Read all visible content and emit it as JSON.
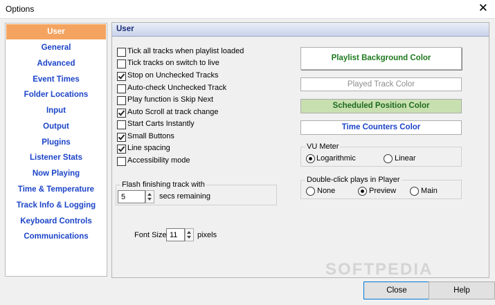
{
  "window": {
    "title": "Options",
    "close_glyph": "✕"
  },
  "sidebar": {
    "items": [
      {
        "label": "User",
        "active": true
      },
      {
        "label": "General"
      },
      {
        "label": "Advanced"
      },
      {
        "label": "Event Times"
      },
      {
        "label": "Folder Locations"
      },
      {
        "label": "Input"
      },
      {
        "label": "Output"
      },
      {
        "label": "Plugins"
      },
      {
        "label": "Listener Stats"
      },
      {
        "label": "Now Playing"
      },
      {
        "label": "Time & Temperature"
      },
      {
        "label": "Track Info & Logging"
      },
      {
        "label": "Keyboard Controls"
      },
      {
        "label": "Communications"
      }
    ]
  },
  "panel": {
    "title": "User",
    "checkboxes": [
      {
        "label": "Tick all tracks when playlist loaded",
        "checked": false
      },
      {
        "label": "Tick tracks on switch to live",
        "checked": false
      },
      {
        "label": "Stop on Unchecked Tracks",
        "checked": true
      },
      {
        "label": "Auto-check Unchecked Track",
        "checked": false
      },
      {
        "label": "Play function is Skip Next",
        "checked": false
      },
      {
        "label": "Auto Scroll at track change",
        "checked": true
      },
      {
        "label": "Start Carts Instantly",
        "checked": false
      },
      {
        "label": "Small Buttons",
        "checked": true
      },
      {
        "label": "Line spacing",
        "checked": true
      },
      {
        "label": "Accessibility mode",
        "checked": false
      }
    ],
    "flash": {
      "legend": "Flash finishing track with",
      "value": "5",
      "suffix": "secs remaining"
    },
    "font_size": {
      "label": "Font Size",
      "value": "11",
      "suffix": "pixels"
    },
    "color_buttons": {
      "playlist_bg": {
        "label": "Playlist Background Color",
        "color": "#1e7a1e"
      },
      "played_track": {
        "label": "Played Track Color",
        "color": "#8c8c8c"
      },
      "scheduled": {
        "label": "Scheduled Position Color",
        "color": "#1e6a1e",
        "bg": "#c8e0b0"
      },
      "time_counters": {
        "label": "Time Counters Color",
        "color": "#1c44c8"
      }
    },
    "vu_meter": {
      "legend": "VU Meter",
      "options": [
        {
          "label": "Logarithmic",
          "selected": true
        },
        {
          "label": "Linear",
          "selected": false
        }
      ]
    },
    "double_click": {
      "legend": "Double-click plays in Player",
      "options": [
        {
          "label": "None",
          "selected": false
        },
        {
          "label": "Preview",
          "selected": true
        },
        {
          "label": "Main",
          "selected": false
        }
      ]
    }
  },
  "footer": {
    "close_label": "Close",
    "help_label": "Help"
  },
  "watermark": "SOFTPEDIA"
}
